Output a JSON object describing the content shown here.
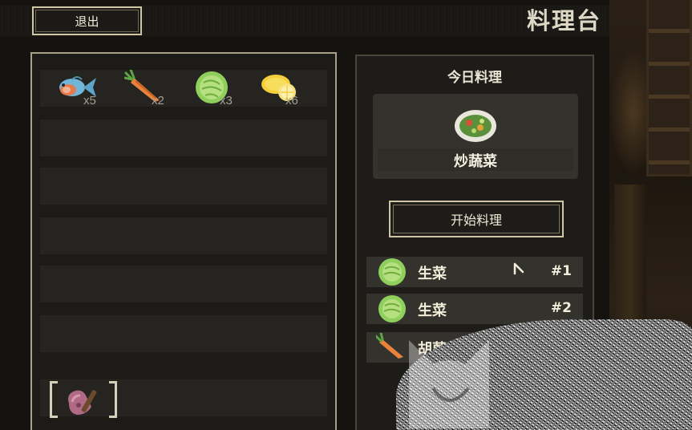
{
  "header": {
    "exit_label": "退出",
    "title": "料理台"
  },
  "inventory": {
    "items": [
      {
        "icon": "fish-icon",
        "count": "x5"
      },
      {
        "icon": "carrot-icon",
        "count": "x2"
      },
      {
        "icon": "lettuce-icon",
        "count": "x3"
      },
      {
        "icon": "lemon-icon",
        "count": "x6"
      }
    ],
    "tool_icon": "cleaver-tool-icon"
  },
  "recipe": {
    "today_label": "今日料理",
    "dish_name": "炒蔬菜",
    "dish_icon": "stir-fried-vegetables-icon",
    "start_label": "开始料理",
    "ingredients": [
      {
        "icon": "lettuce-icon",
        "label": "生菜",
        "num": "#1"
      },
      {
        "icon": "lettuce-icon",
        "label": "生菜",
        "num": "#2"
      },
      {
        "icon": "carrot-icon",
        "label": "胡萝",
        "num": ""
      }
    ]
  },
  "colors": {
    "panel_border": "#a9a284",
    "text_light": "#f2edd9",
    "background": "#15130f"
  }
}
